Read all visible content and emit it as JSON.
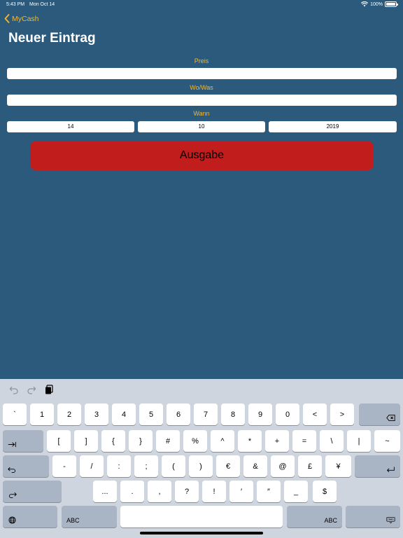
{
  "status": {
    "time": "5:43 PM",
    "date": "Mon Oct 14",
    "battery": "100%"
  },
  "nav": {
    "back_label": "MyCash",
    "title": "Neuer Eintrag"
  },
  "form": {
    "preis_label": "Preis",
    "wowas_label": "Wo/Was",
    "wann_label": "Wann",
    "preis_value": "",
    "wowas_value": "",
    "day": "14",
    "month": "10",
    "year": "2019"
  },
  "button": {
    "label": "Ausgabe"
  },
  "colors": {
    "background": "#2c5a7c",
    "accent": "#f0b83a",
    "button": "#c11d1d",
    "keyboard": "#cfd5de"
  },
  "keyboard": {
    "toolbar_icons": [
      "undo-icon",
      "redo-icon",
      "paste-icon"
    ],
    "row1": [
      "`",
      "1",
      "2",
      "3",
      "4",
      "5",
      "6",
      "7",
      "8",
      "9",
      "0",
      "<",
      ">"
    ],
    "row2": [
      "[",
      "]",
      "{",
      "}",
      "#",
      "%",
      "^",
      "*",
      "+",
      "=",
      "\\",
      "|",
      "~"
    ],
    "row3": [
      "-",
      "/",
      ":",
      ";",
      "(",
      ")",
      "€",
      "&",
      "@",
      "£",
      "¥"
    ],
    "row4": [
      "...",
      ".",
      ",",
      "?",
      "!",
      "′",
      "″",
      "_",
      "$"
    ],
    "abc_left": "ABC",
    "abc_right": "ABC"
  }
}
